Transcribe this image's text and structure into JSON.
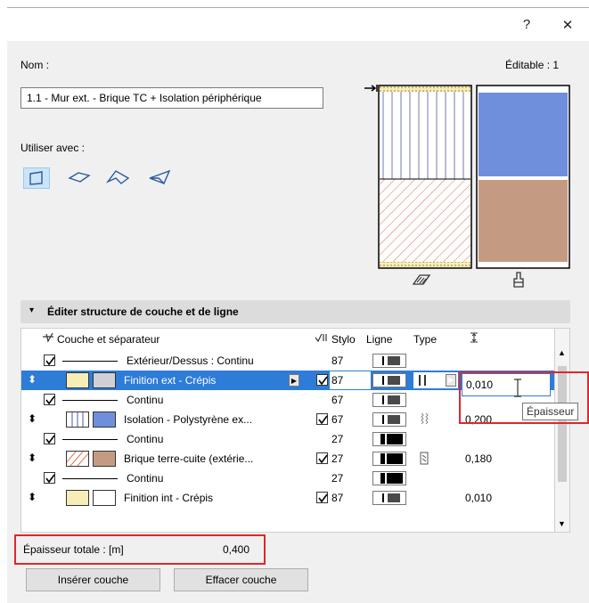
{
  "window": {
    "help_label": "?",
    "close_label": "✕"
  },
  "name_section": {
    "label": "Nom :",
    "editable_text": "Éditable : 1",
    "value": "1.1 - Mur ext. - Brique TC + Isolation périphérique"
  },
  "use_with": {
    "label": "Utiliser avec :",
    "tools": [
      "wall-tool-icon",
      "slab-tool-icon",
      "roof-tool-icon",
      "shell-tool-icon"
    ]
  },
  "preview_icons": {
    "left": "cut-fill-icon",
    "right": "brush-icon"
  },
  "section": {
    "title": "Éditer structure de couche et de ligne"
  },
  "table": {
    "headers": {
      "layer": "Couche et séparateur",
      "stylo": "Stylo",
      "ligne": "Ligne",
      "type": "Type"
    },
    "rows": [
      {
        "kind": "sep",
        "label": "Extérieur/Dessus : Continu",
        "pen": "87",
        "line": "thin"
      },
      {
        "kind": "layer",
        "label": "Finition ext - Crépis",
        "pen": "87",
        "value": "0,010",
        "selected": true,
        "swatch": "#cfcfd6"
      },
      {
        "kind": "sep",
        "label": "Continu",
        "pen": "67",
        "line": "thin"
      },
      {
        "kind": "layer",
        "label": "Isolation - Polystyrène ex...",
        "pen": "67",
        "value": "0,200",
        "swatch": "#6f8edc"
      },
      {
        "kind": "sep",
        "label": "Continu",
        "pen": "27",
        "line": "thick"
      },
      {
        "kind": "layer",
        "label": "Brique terre-cuite (extérie...",
        "pen": "27",
        "value": "0,180",
        "swatch": "#c59a83"
      },
      {
        "kind": "sep",
        "label": "Continu",
        "pen": "27",
        "line": "thick"
      },
      {
        "kind": "layer",
        "label": "Finition int - Crépis",
        "pen": "87",
        "value": "0,010",
        "swatch": "#ffffff"
      }
    ]
  },
  "tooltip": "Épaisseur",
  "total": {
    "label": "Épaisseur totale : [m]",
    "value": "0,400"
  },
  "buttons": {
    "insert": "Insérer couche",
    "delete": "Effacer couche"
  },
  "colors": {
    "selection": "#2d7cd8",
    "highlight": "#e0262d",
    "insulation": "#6f8edc",
    "brick": "#c59a83"
  }
}
